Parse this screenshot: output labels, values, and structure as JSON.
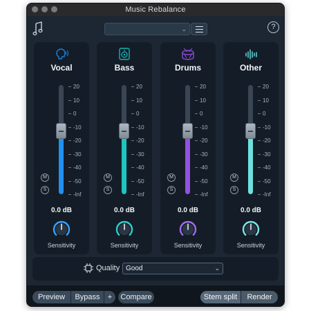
{
  "window": {
    "title": "Music Rebalance"
  },
  "toolbar": {
    "preset_value": "",
    "logo_icon": "music-note-icon",
    "menu_icon": "hamburger-menu-icon",
    "help_label": "?"
  },
  "strips": [
    {
      "name": "Vocal",
      "icon": "vocal-head-icon",
      "color": "#1e7fd8",
      "fill_color": "#2190f0",
      "gain": "0.0 dB",
      "level": 0.58,
      "mute": "M",
      "solo": "S",
      "sensitivity_label": "Sensitivity",
      "knob_color": "#3aa0ff"
    },
    {
      "name": "Bass",
      "icon": "bass-speaker-icon",
      "color": "#18b3b3",
      "fill_color": "#1fc4c1",
      "gain": "0.0 dB",
      "level": 0.58,
      "mute": "M",
      "solo": "S",
      "sensitivity_label": "Sensitivity",
      "knob_color": "#2fd0cf"
    },
    {
      "name": "Drums",
      "icon": "drum-icon",
      "color": "#8c4bd6",
      "fill_color": "#944fe3",
      "gain": "0.0 dB",
      "level": 0.58,
      "mute": "M",
      "solo": "S",
      "sensitivity_label": "Sensitivity",
      "knob_color": "#a26cf0"
    },
    {
      "name": "Other",
      "icon": "waveform-icon",
      "color": "#5fd8d8",
      "fill_color": "#6ee0de",
      "gain": "0.0 dB",
      "level": 0.58,
      "mute": "M",
      "solo": "S",
      "sensitivity_label": "Sensitivity",
      "knob_color": "#7be7e6"
    }
  ],
  "scale": [
    "20",
    "10",
    "0",
    "-10",
    "-20",
    "-30",
    "-40",
    "-50",
    "-Inf"
  ],
  "quality": {
    "label": "Quality",
    "value": "Good",
    "icon": "quality-icon"
  },
  "bottom": {
    "preview": "Preview",
    "bypass": "Bypass",
    "plus": "+",
    "compare": "Compare",
    "stem_split": "Stem split",
    "render": "Render"
  }
}
